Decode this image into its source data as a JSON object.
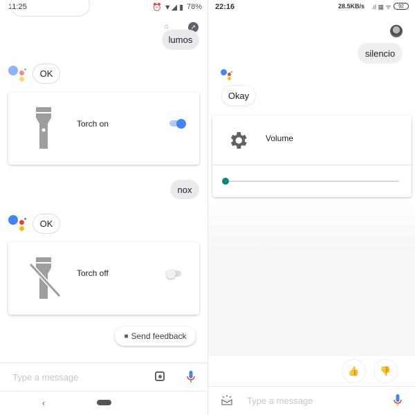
{
  "left": {
    "status": {
      "time": "11:25",
      "battery": "78%"
    },
    "messages": [
      {
        "role": "user",
        "text": "lumos"
      },
      {
        "role": "assistant",
        "text": "OK"
      },
      {
        "role": "user",
        "text": "nox"
      },
      {
        "role": "assistant",
        "text": "OK"
      }
    ],
    "cards": [
      {
        "icon": "flashlight-icon",
        "label": "Torch on",
        "toggle_on": true
      },
      {
        "icon": "flashlight-off-icon",
        "label": "Torch off",
        "toggle_on": false
      }
    ],
    "send_feedback": "Send feedback",
    "input_placeholder": "Type a message",
    "colors": {
      "toggle_on": "#4285f4",
      "mic_blue": "#4285f4"
    }
  },
  "right": {
    "status": {
      "time": "22:16",
      "net": "28.5KB/s",
      "battery": "92"
    },
    "messages": [
      {
        "role": "user",
        "text": "silencio"
      },
      {
        "role": "assistant",
        "text": "Okay"
      }
    ],
    "card": {
      "icon": "gear-icon",
      "label": "Volume",
      "volume_level": 0
    },
    "input_placeholder": "Type a message",
    "colors": {
      "slider": "#00897b"
    }
  }
}
